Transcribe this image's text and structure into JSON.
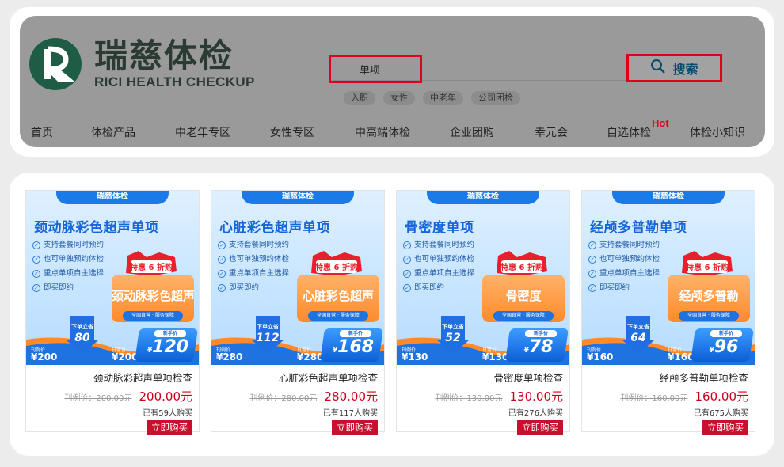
{
  "logo": {
    "cn": "瑞慈体检",
    "en": "RICI HEALTH CHECKUP",
    "mark_color": "#1e5c46"
  },
  "search": {
    "value": "单项",
    "button_label": "搜索",
    "icon": "search-icon"
  },
  "tags": [
    "入职",
    "女性",
    "中老年",
    "公司团检"
  ],
  "nav": [
    "首页",
    "体检产品",
    "中老年专区",
    "女性专区",
    "中高端体检",
    "企业团购",
    "幸元会",
    "自选体检",
    "体检小知识"
  ],
  "nav_hot": "Hot",
  "accent_color": "#e0001b",
  "products": [
    {
      "brand": "瑞慈体检",
      "banner_title": "颈动脉彩色超声单项",
      "features": [
        "支持套餐同时预约",
        "也可单独预约体检",
        "重点单项自主选择",
        "即买即约"
      ],
      "discount": "特惠 6 折购",
      "box_label": "颈动脉彩色超声",
      "box_sub": "全国直营 · 服务保障",
      "arrow_label": "下单立省",
      "arrow_value": "80",
      "price_a_label": "刊例价",
      "price_a": "¥200",
      "price_b_label": "日常价",
      "price_b": "¥200",
      "deal_label": "新手价",
      "deal_value": "120",
      "name": "颈动脉彩超声单项检查",
      "old_price": "刊例价：200.00元",
      "price": "200.00元",
      "sold": "已有59人购买",
      "buy": "立即购买"
    },
    {
      "brand": "瑞慈体检",
      "banner_title": "心脏彩色超声单项",
      "features": [
        "支持套餐同时预约",
        "也可单独预约体检",
        "重点单项自主选择",
        "即买即约"
      ],
      "discount": "特惠 6 折购",
      "box_label": "心脏彩色超声",
      "box_sub": "全国直营 · 服务保障",
      "arrow_label": "下单立省",
      "arrow_value": "112",
      "price_a_label": "刊例价",
      "price_a": "¥280",
      "price_b_label": "日常价",
      "price_b": "¥280",
      "deal_label": "新手价",
      "deal_value": "168",
      "name": "心脏彩色超声单项检查",
      "old_price": "刊例价：280.00元",
      "price": "280.00元",
      "sold": "已有117人购买",
      "buy": "立即购买"
    },
    {
      "brand": "瑞慈体检",
      "banner_title": "骨密度单项",
      "features": [
        "支持套餐同时预约",
        "也可单独预约体检",
        "重点单项自主选择",
        "即买即约"
      ],
      "discount": "特惠 6 折购",
      "box_label": "骨密度",
      "box_sub": "全国直营 · 服务保障",
      "arrow_label": "下单立省",
      "arrow_value": "52",
      "price_a_label": "刊例价",
      "price_a": "¥130",
      "price_b_label": "日常价",
      "price_b": "¥130",
      "deal_label": "新手价",
      "deal_value": "78",
      "name": "骨密度单项检查",
      "old_price": "刊例价：130.00元",
      "price": "130.00元",
      "sold": "已有276人购买",
      "buy": "立即购买"
    },
    {
      "brand": "瑞慈体检",
      "banner_title": "经颅多普勒单项",
      "features": [
        "支持套餐同时预约",
        "也可单独预约体检",
        "重点单项自主选择",
        "即买即约"
      ],
      "discount": "特惠 6 折购",
      "box_label": "经颅多普勒",
      "box_sub": "全国直营 · 服务保障",
      "arrow_label": "下单立省",
      "arrow_value": "64",
      "price_a_label": "刊例价",
      "price_a": "¥160",
      "price_b_label": "日常价",
      "price_b": "¥160",
      "deal_label": "新手价",
      "deal_value": "96",
      "name": "经颅多普勒单项检查",
      "old_price": "刊例价：160.00元",
      "price": "160.00元",
      "sold": "已有675人购买",
      "buy": "立即购买"
    }
  ]
}
